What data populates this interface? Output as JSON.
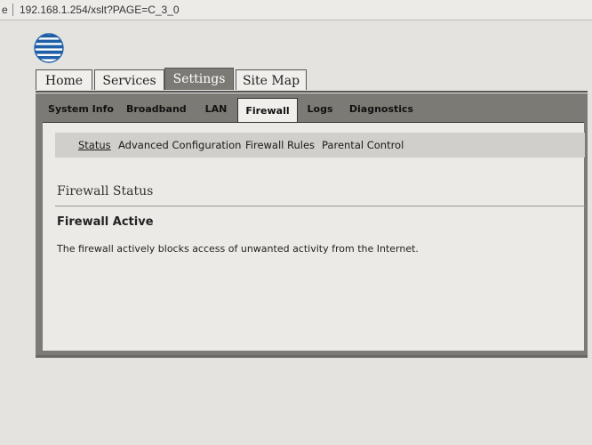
{
  "browser": {
    "url_prefix_fragment": "e",
    "url": "192.168.1.254/xslt?PAGE=C_3_0"
  },
  "logo": {
    "icon": "att-globe-icon",
    "color": "#1f5fa8"
  },
  "main_tabs": [
    {
      "label": "Home",
      "active": false
    },
    {
      "label": "Services",
      "active": false
    },
    {
      "label": "Settings",
      "active": true
    },
    {
      "label": "Site Map",
      "active": false
    }
  ],
  "sub_tabs": [
    {
      "label": "System Info",
      "active": false
    },
    {
      "label": "Broadband",
      "active": false
    },
    {
      "label": "LAN",
      "active": false
    },
    {
      "label": "Firewall",
      "active": true
    },
    {
      "label": "Logs",
      "active": false
    },
    {
      "label": "Diagnostics",
      "active": false
    }
  ],
  "firewall_nav": [
    {
      "label": "Status",
      "active": true
    },
    {
      "label": "Advanced Configuration",
      "active": false
    },
    {
      "label": "Firewall Rules",
      "active": false
    },
    {
      "label": "Parental Control",
      "active": false
    }
  ],
  "content": {
    "section_title": "Firewall Status",
    "status_heading": "Firewall Active",
    "status_description": "The firewall actively blocks access of unwanted activity from the Internet."
  },
  "colors": {
    "tab_active_bg": "#7c7a75",
    "page_bg": "#e4e3df",
    "content_bg": "#eceae6"
  }
}
